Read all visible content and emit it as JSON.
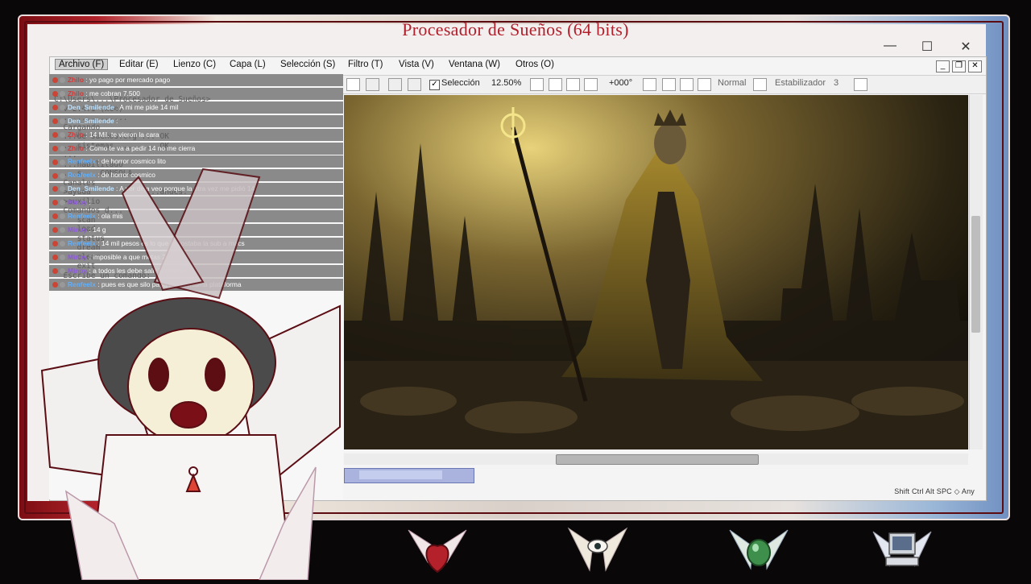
{
  "window": {
    "title": "Procesador de Sueños (64 bits)",
    "minimize_glyph": "—",
    "maximize_glyph": "☐",
    "close_glyph": "✕"
  },
  "menu": [
    {
      "label": "Archivo (F)"
    },
    {
      "label": "Editar (E)"
    },
    {
      "label": "Lienzo (C)"
    },
    {
      "label": "Capa (L)"
    },
    {
      "label": "Selección (S)"
    },
    {
      "label": "Filtro (T)"
    },
    {
      "label": "Vista (V)"
    },
    {
      "label": "Ventana (W)"
    },
    {
      "label": "Otros (O)"
    }
  ],
  "toolbar": {
    "selection_label": "Selección",
    "zoom": "12.50%",
    "rotation": "+000°",
    "blend_mode": "Normal",
    "stabilizer_label": "Estabilizador",
    "stabilizer_value": "3"
  },
  "status": {
    "keys": "Shift Ctrl Alt SPC ◇ Any"
  },
  "terminal": {
    "lines": [
      "C:\\Users\\...\\Procesador de Sueños>",
      "",
      "",
      "  v 2.4.1 (x64)",
      "  ..............",
      "  Cargando",
      "  ...de sueños.cfg ... OK",
      "  ...sistemas ........ OK",
      "  ...",
      "  ...habilitado",
      "",
      "",
      "  ...s    CONSOLA",
      "",
      "",
      "  Canales",
      "",
      "  >ayuda            ...andes.",
      "  >auxilio",
      "",
      "  Comandos d...",
      "",
      "     scan",
      "     load",
      "     status",
      "     dream",
      "     clear",
      "     exit",
      "",
      "  Escribe un comando: _"
    ]
  },
  "chat": [
    {
      "user": "Zhilo",
      "text": "yo pago por mercado pago",
      "color": "#d23b3b"
    },
    {
      "user": "Zhilo",
      "text": "me cobran 7.500",
      "color": "#d23b3b"
    },
    {
      "user": "Den_Smilende",
      "text": "A mi me pide 14 mil",
      "color": "#bfe3ff"
    },
    {
      "user": "Den_Smilende",
      "text": "",
      "color": "#bfe3ff"
    },
    {
      "user": "Zhilo",
      "text": "14 Mil. te vieron la cara",
      "color": "#d23b3b"
    },
    {
      "user": "Zhilo",
      "text": "Como te va a pedir 14 no me cierra",
      "color": "#d23b3b"
    },
    {
      "user": "Renfeelx",
      "text": "de horror cosmico lito",
      "color": "#5fb0ff"
    },
    {
      "user": "Renfeelx",
      "text": "de horror cosmico",
      "color": "#5fb0ff"
    },
    {
      "user": "Den_Smilende",
      "text": "A ver deja veo porque la otra vez me pidió 14",
      "color": "#bfe3ff"
    },
    {
      "user": "Minoy",
      "text": "",
      "color": "#8c5bd6"
    },
    {
      "user": "Renfeelx",
      "text": "ola mis",
      "color": "#5fb0ff"
    },
    {
      "user": "Minoy",
      "text": "14 g",
      "color": "#8c5bd6"
    },
    {
      "user": "Renfeelx",
      "text": "14 mil pesos es lo que le costaba la sub a macs",
      "color": "#5fb0ff"
    },
    {
      "user": "Minoy",
      "text": "imposible a que metas 2",
      "color": "#8c5bd6"
    },
    {
      "user": "Minoy",
      "text": "a todos les debe salir lo mismo",
      "color": "#8c5bd6"
    },
    {
      "user": "Renfeelx",
      "text": "pues es que silo paga por la misma plataforma",
      "color": "#5fb0ff"
    }
  ],
  "dock": [
    {
      "icon": "heart-wings-icon"
    },
    {
      "icon": "eye-wings-icon"
    },
    {
      "icon": "gem-wings-icon"
    },
    {
      "icon": "computer-icon"
    }
  ],
  "colors": {
    "title": "#b01f2c",
    "frame_red": "#8a1017",
    "canvas_bg": "#120e09"
  }
}
